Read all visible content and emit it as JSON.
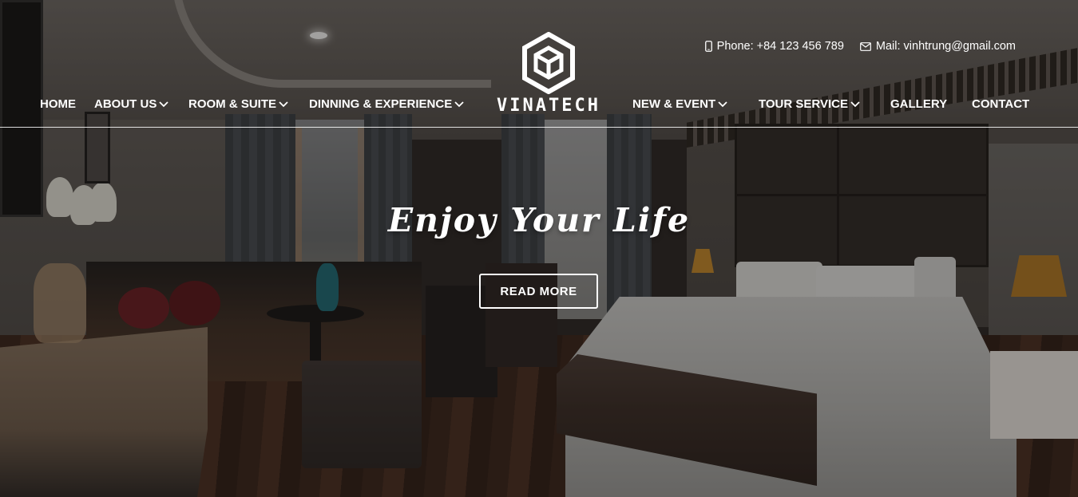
{
  "header": {
    "phone_label": "Phone: +84 123 456 789",
    "mail_label": "Mail: vinhtrung@gmail.com",
    "phone_icon": "phone-icon",
    "mail_icon": "mail-icon"
  },
  "logo": {
    "text": "VINATECH",
    "icon": "cube-logo-icon"
  },
  "nav": {
    "items": [
      {
        "label": "HOME",
        "has_dropdown": false
      },
      {
        "label": "ABOUT US",
        "has_dropdown": true
      },
      {
        "label": "ROOM & SUITE",
        "has_dropdown": true
      },
      {
        "label": "DINNING & EXPERIENCE",
        "has_dropdown": true
      },
      {
        "label": "NEW & EVENT",
        "has_dropdown": true
      },
      {
        "label": "TOUR SERVICE",
        "has_dropdown": true
      },
      {
        "label": "GALLERY",
        "has_dropdown": false
      },
      {
        "label": "CONTACT",
        "has_dropdown": false
      }
    ]
  },
  "hero": {
    "headline": "Enjoy Your Life",
    "cta_label": "READ MORE"
  },
  "colors": {
    "text": "#ffffff",
    "overlay": "#141210"
  }
}
